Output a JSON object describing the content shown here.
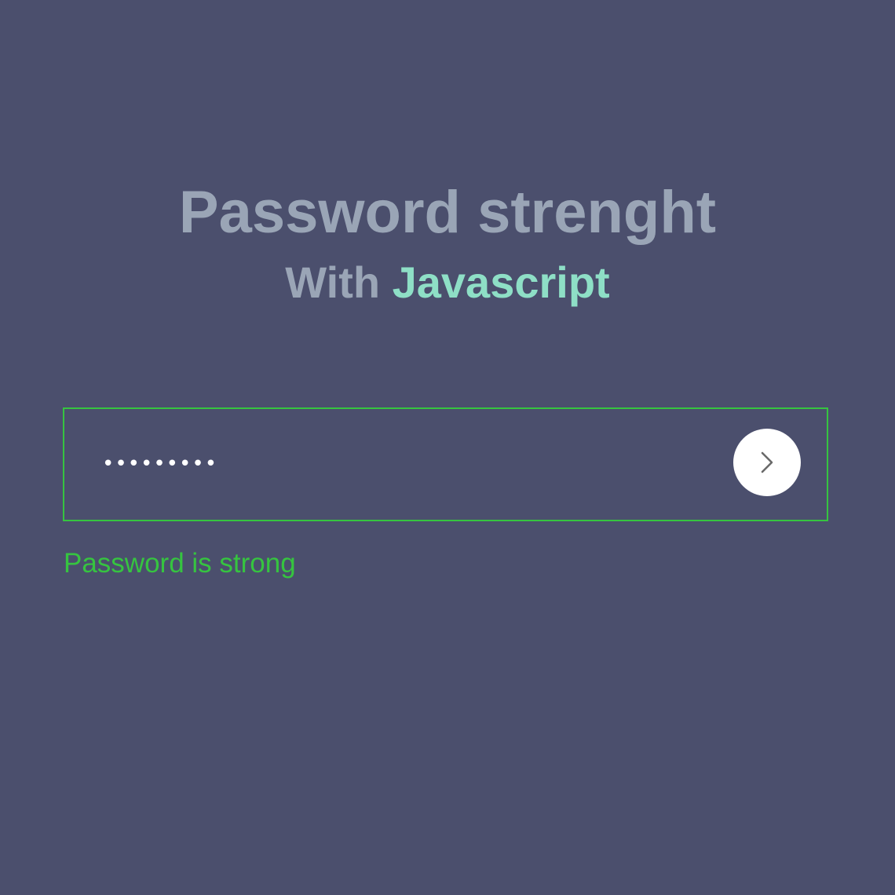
{
  "header": {
    "title": "Password strenght",
    "subtitle_prefix": "With",
    "subtitle_accent": "Javascript"
  },
  "password_field": {
    "value": "•••••••••",
    "input_type": "password"
  },
  "submit_button": {
    "icon": "chevron-right-icon"
  },
  "status": {
    "message": "Password is strong"
  },
  "colors": {
    "background": "#4b4f6d",
    "title_text": "#9aa5b6",
    "accent_text": "#8edfc6",
    "strong_indicator": "#36c440",
    "button_background": "#ffffff"
  }
}
